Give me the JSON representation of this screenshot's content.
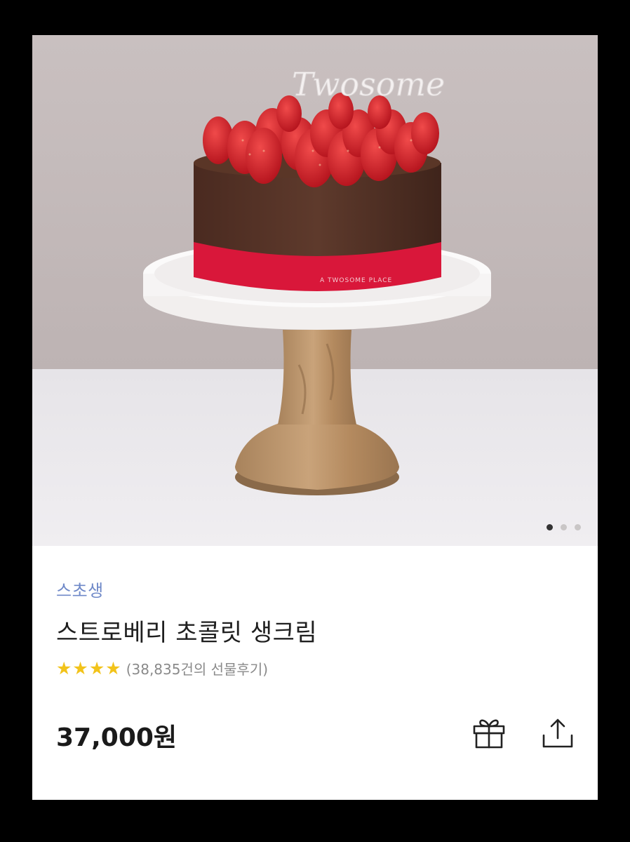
{
  "product": {
    "brand": "스초생",
    "title": "스트로베리 초콜릿 생크림",
    "rating_stars": 4,
    "reviews_text": "(38,835건의 선물후기)",
    "price": "37,000원"
  },
  "image": {
    "topper_text": "Twosome",
    "ribbon_text": "A TWOSOME PLACE",
    "carousel_total": 3,
    "carousel_active": 1
  },
  "icons": {
    "star": "star-icon",
    "gift": "gift-icon",
    "share": "share-icon"
  },
  "colors": {
    "brand_link": "#6f89c8",
    "star": "#f2c31a",
    "ribbon": "#d9173a"
  }
}
